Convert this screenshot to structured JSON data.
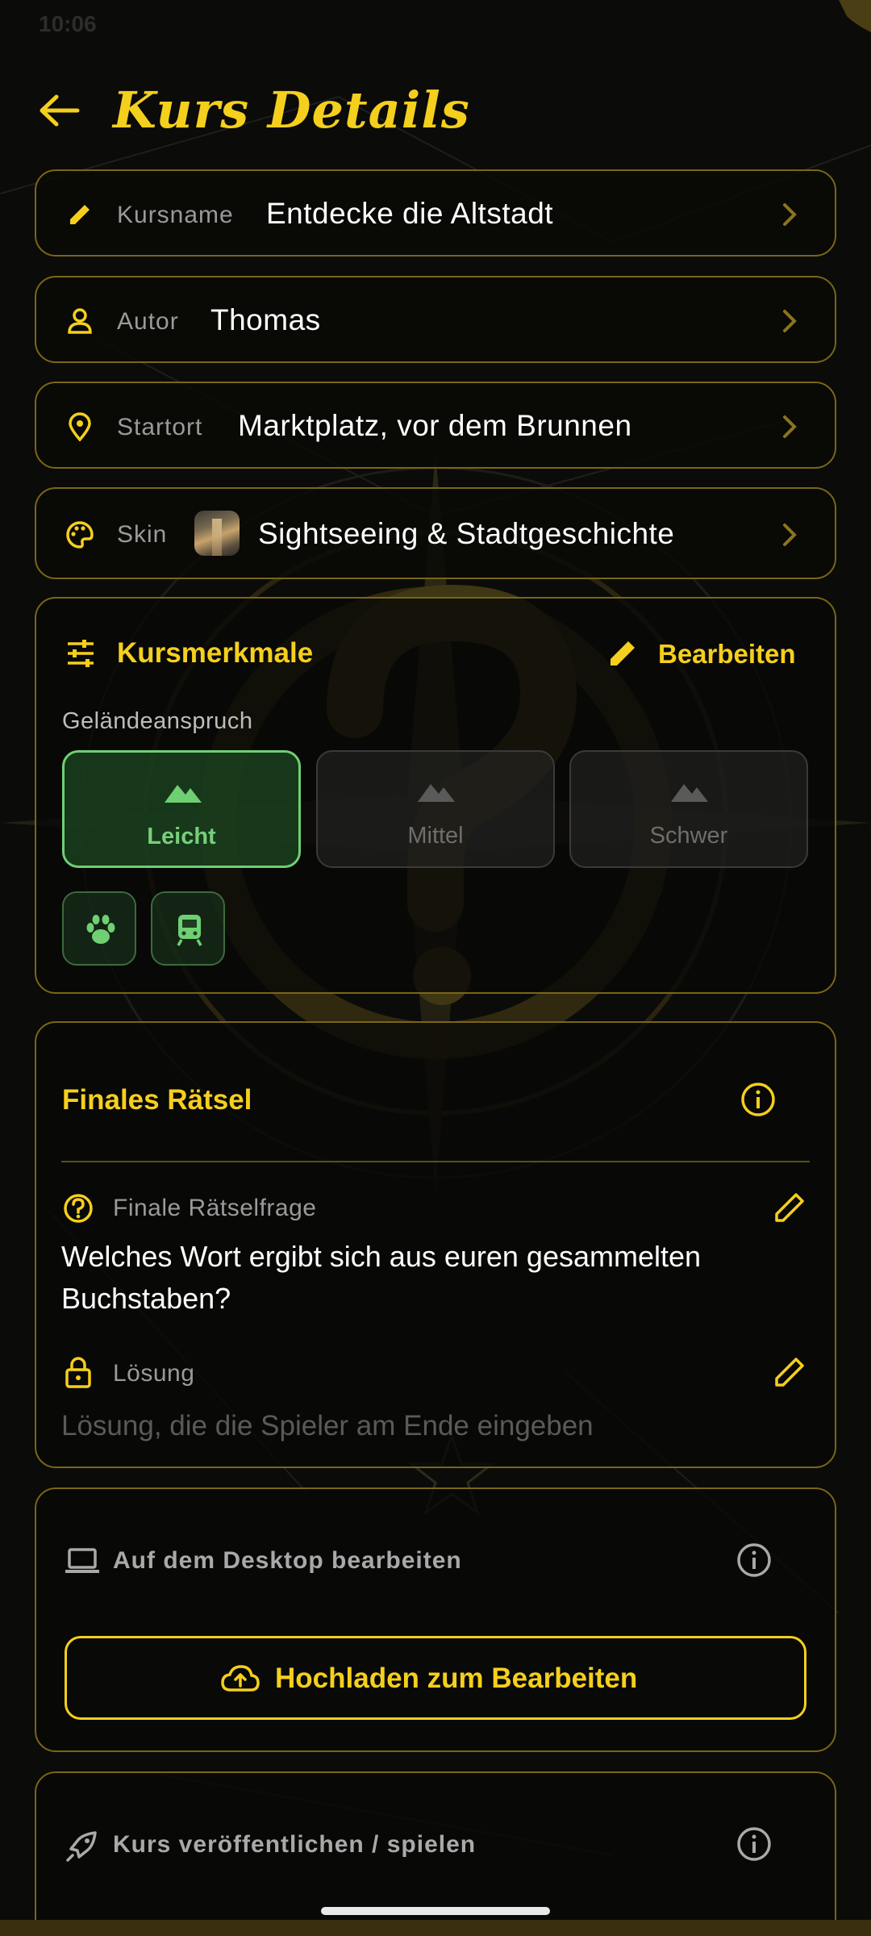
{
  "status_bar": {
    "time": "10:06"
  },
  "header": {
    "title": "Kurs Details"
  },
  "fields": {
    "course_name": {
      "label": "Kursname",
      "value": "Entdecke die Altstadt"
    },
    "author": {
      "label": "Autor",
      "value": "Thomas"
    },
    "start_location": {
      "label": "Startort",
      "value": "Marktplatz, vor dem Brunnen"
    },
    "skin": {
      "label": "Skin",
      "value": "Sightseeing & Stadtgeschichte"
    }
  },
  "features": {
    "title": "Kursmerkmale",
    "edit_label": "Bearbeiten",
    "terrain_label": "Geländeanspruch",
    "difficulties": [
      {
        "label": "Leicht",
        "selected": true
      },
      {
        "label": "Mittel",
        "selected": false
      },
      {
        "label": "Schwer",
        "selected": false
      }
    ],
    "tags": [
      "paw-icon",
      "train-icon"
    ]
  },
  "final_riddle": {
    "title": "Finales Rätsel",
    "question_label": "Finale Rätselfrage",
    "question_text": "Welches Wort ergibt sich aus euren gesammelten Buchstaben?",
    "solution_label": "Lösung",
    "solution_placeholder": "Lösung, die die Spieler am Ende eingeben"
  },
  "desktop": {
    "title": "Auf dem Desktop bearbeiten",
    "upload_label": "Hochladen zum Bearbeiten"
  },
  "publish": {
    "title": "Kurs veröffentlichen / spielen"
  },
  "colors": {
    "accent": "#f5cf1d",
    "border": "#7a6615",
    "success": "#6fcf73",
    "background": "#0b0b09"
  }
}
